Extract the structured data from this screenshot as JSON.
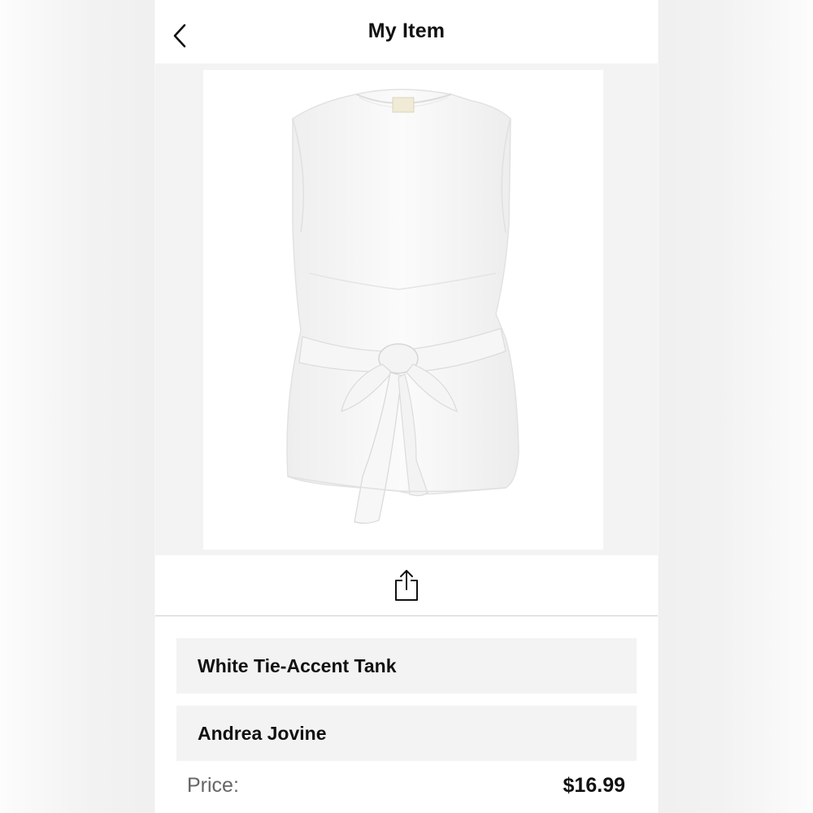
{
  "header": {
    "title": "My Item",
    "back_icon": "chevron-left-icon"
  },
  "product": {
    "image_alt": "White sleeveless tank top with front tie",
    "name": "White Tie-Accent Tank",
    "brand": "Andrea Jovine",
    "price_label": "Price:",
    "price_value": "$16.99"
  },
  "actions": {
    "share_icon": "share-icon"
  }
}
